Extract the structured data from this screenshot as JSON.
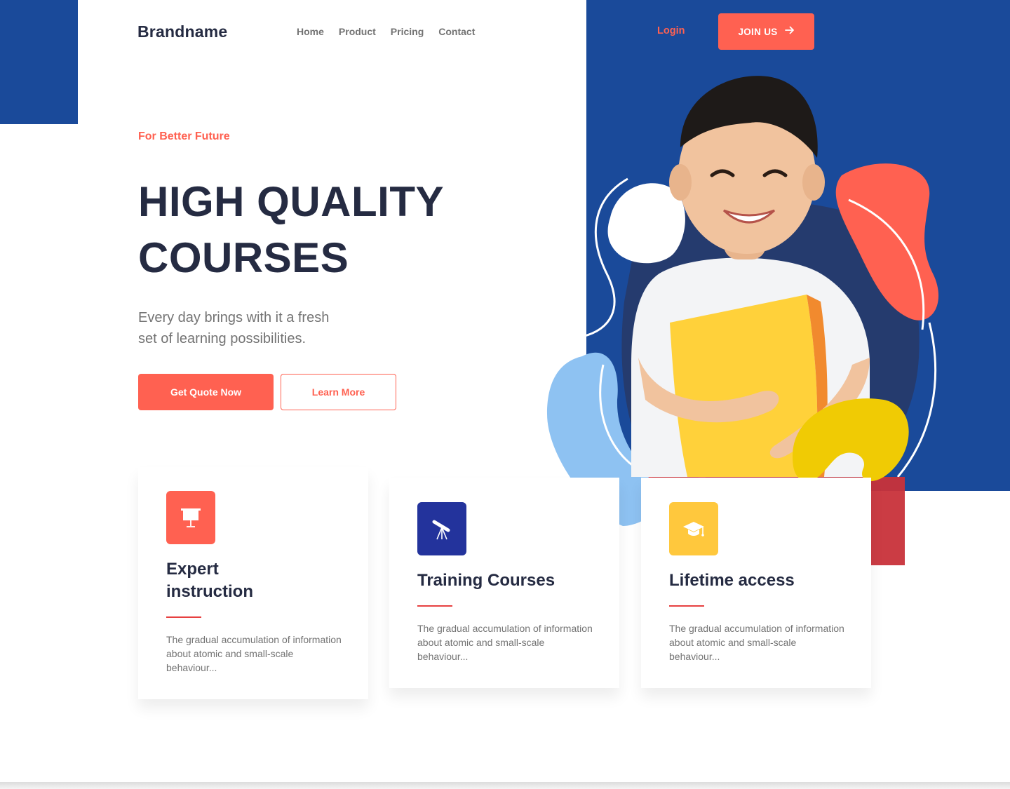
{
  "colors": {
    "primary_blue": "#1A4A9A",
    "accent": "#FF6151",
    "dark": "#252B42",
    "muted": "#737373",
    "navy_icon": "#23339C",
    "yellow": "#FFC83D",
    "rule": "#E74040"
  },
  "header": {
    "brand": "Brandname",
    "nav": [
      "Home",
      "Product",
      "Pricing",
      "Contact"
    ],
    "login_label": "Login",
    "join_label": "JOIN US",
    "join_icon": "arrow-right-icon"
  },
  "hero": {
    "kicker": "For Better Future",
    "title_line1": "HIGH QUALITY",
    "title_line2": "COURSES",
    "subtitle_line1": "Every day brings with it a fresh",
    "subtitle_line2": "set of learning possibilities.",
    "primary_cta": "Get Quote Now",
    "secondary_cta": "Learn More"
  },
  "features": [
    {
      "icon": "presentation-board-icon",
      "title": "Expert instruction",
      "desc": "The gradual accumulation of information about atomic and small-scale behaviour..."
    },
    {
      "icon": "telescope-icon",
      "title": "Training Courses",
      "desc": "The gradual accumulation of information about atomic and small-scale behaviour..."
    },
    {
      "icon": "graduation-cap-icon",
      "title": "Lifetime access",
      "desc": "The gradual accumulation of information about atomic and small-scale behaviour..."
    }
  ]
}
